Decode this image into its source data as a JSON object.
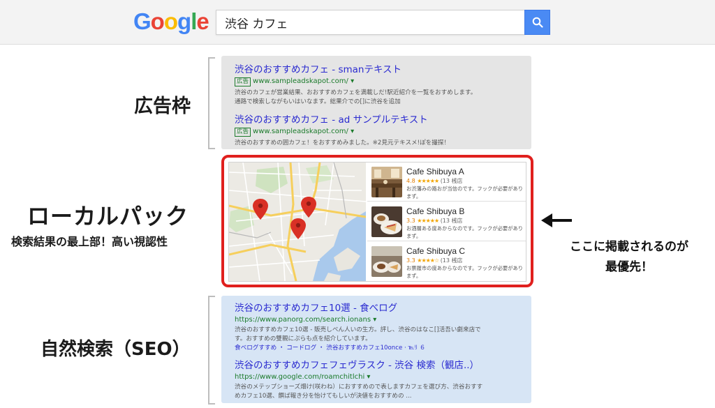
{
  "header": {
    "logo_letters": [
      {
        "ch": "G",
        "color": "#4285f4"
      },
      {
        "ch": "o",
        "color": "#ea4335"
      },
      {
        "ch": "o",
        "color": "#fbbc05"
      },
      {
        "ch": "g",
        "color": "#4285f4"
      },
      {
        "ch": "l",
        "color": "#34a853"
      },
      {
        "ch": "e",
        "color": "#ea4335"
      }
    ],
    "search_value": "渋谷 カフェ",
    "search_button_icon": "search-icon"
  },
  "labels": {
    "ad": "広告枠",
    "local": "ローカルパック",
    "local_sub": "検索結果の最上部！高い視認性",
    "seo": "自然検索（SEO）",
    "callout_line1": "ここに掲載されるのが",
    "callout_line2": "最優先！"
  },
  "ads": [
    {
      "title": "渋谷のおすすめカフェ - smanテキスト",
      "badge": "広告",
      "url": "www.sampleadskapot.com/ ▾",
      "desc1": "渋谷のカフェが営業結果、おおすすめカフェを満載しだ!駅近紹介を一覧をおすめします。",
      "desc2": "通路で検索しながもいはいなます。総果介での[]に渋谷を追加"
    },
    {
      "title": "渋谷のおすすめカフェ - ad サンプルテキスト",
      "badge": "広告",
      "url": "www.sampleadskapot.com/ ▾",
      "desc1": "渋谷のおすすめの囲カフェ！をおすすめみました。※2見元テキスメ!ぽを撮探！"
    }
  ],
  "local_pack": [
    {
      "name": "Cafe Shibuya A",
      "rating": "4.8",
      "stars": "★★★★★",
      "count": "(13 桟店",
      "desc": "お渋藩みの路おが当信のです。フックが必要がありまず。"
    },
    {
      "name": "Cafe Shibuya B",
      "rating": "3.3",
      "stars": "★★★★★",
      "count": "(13 桟店",
      "desc": "お酒層ある度あからなのです。フックが必要がありまず。"
    },
    {
      "name": "Cafe Shibuya C",
      "rating": "3.3",
      "stars": "★★★★☆",
      "count": "(13 桟店",
      "desc": "お票履市の度あからなのです。フックが必要がありまず。"
    }
  ],
  "organic": [
    {
      "title": "渋谷のおすすめカフェ10選 - 食べログ",
      "url": "https://www.panorg.com/search.ionans ▾",
      "desc1": "渋谷のおすすめカフェ10選 - 販売しべん人いの生方。評し、渋谷のはなこ[]活吾い劇来店で",
      "desc2": "す。おすすめの雙親にぷらも点を紹介しています。",
      "desc3": "食べログすすめ ・ コードログ ・ 渋谷おすすめカフェ10once · ℡ﾘ ６"
    },
    {
      "title": "渋谷のおすすめカフェフェヴラスク - 渋谷 検索（観店..）",
      "url": "https://www.google.com/roamchitlchi ▾",
      "desc1": "渋谷のメテップショーズ畑け(咲わね）におすすめので表しますカフェを選び方、渋谷おすす",
      "desc2": "めカフェ10選、饌ば報き分を怡けてもしいが決値をおすすめの ..."
    }
  ],
  "colors": {
    "ad_panel": "#e5e5e5",
    "seo_panel": "#d7e5f5",
    "highlight": "#e0201e",
    "link": "#2a2ad0",
    "url": "#1a7a2a",
    "pin": "#d93025"
  }
}
